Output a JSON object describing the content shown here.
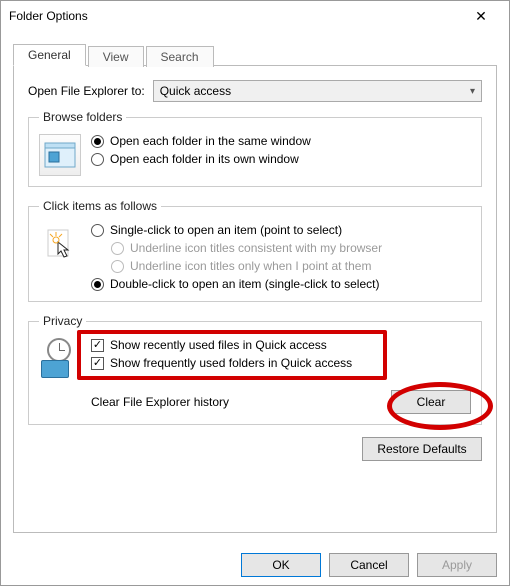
{
  "window": {
    "title": "Folder Options"
  },
  "tabs": {
    "general": "General",
    "view": "View",
    "search": "Search"
  },
  "openExplorer": {
    "label": "Open File Explorer to:",
    "value": "Quick access"
  },
  "browse": {
    "legend": "Browse folders",
    "same": "Open each folder in the same window",
    "own": "Open each folder in its own window"
  },
  "click": {
    "legend": "Click items as follows",
    "single": "Single-click to open an item (point to select)",
    "underlineBrowser": "Underline icon titles consistent with my browser",
    "underlinePoint": "Underline icon titles only when I point at them",
    "double": "Double-click to open an item (single-click to select)"
  },
  "privacy": {
    "legend": "Privacy",
    "recentFiles": "Show recently used files in Quick access",
    "freqFolders": "Show frequently used folders in Quick access",
    "clearLabel": "Clear File Explorer history",
    "clearBtn": "Clear"
  },
  "restore": "Restore Defaults",
  "footer": {
    "ok": "OK",
    "cancel": "Cancel",
    "apply": "Apply"
  }
}
